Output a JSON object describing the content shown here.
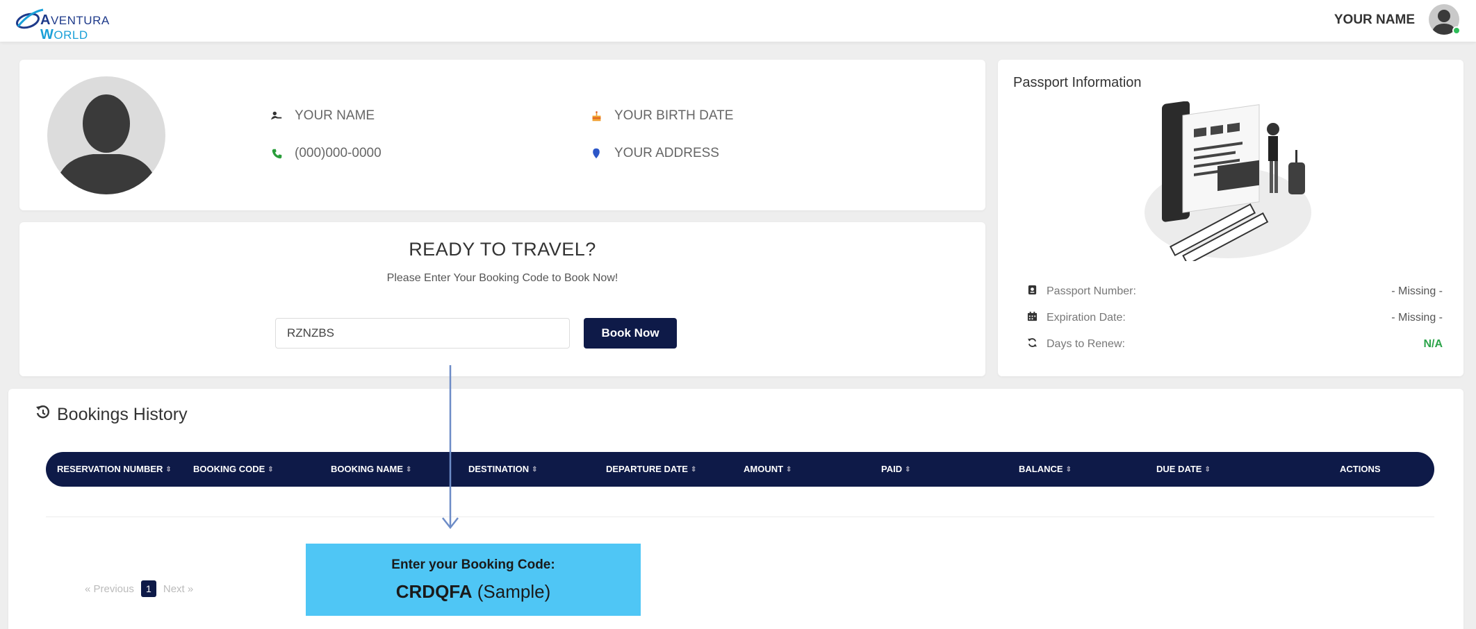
{
  "header": {
    "logo_line1_initial": "A",
    "logo_line1_rest": "VENTURA",
    "logo_line2_initial": "W",
    "logo_line2_rest": "ORLD",
    "user_name": "YOUR NAME"
  },
  "profile": {
    "name": "YOUR NAME",
    "phone": "(000)000-0000",
    "birth_date": "YOUR BIRTH DATE",
    "address": "YOUR ADDRESS"
  },
  "ready": {
    "title": "READY TO TRAVEL?",
    "subtitle": "Please Enter Your Booking Code to Book Now!",
    "code_value": "RZNZBS",
    "book_button": "Book Now"
  },
  "passport": {
    "title": "Passport Information",
    "rows": [
      {
        "label": "Passport Number:",
        "value": "- Missing -",
        "icon": "passport-icon"
      },
      {
        "label": "Expiration Date:",
        "value": "- Missing -",
        "icon": "calendar-icon"
      },
      {
        "label": "Days to Renew:",
        "value": "N/A",
        "icon": "refresh-icon"
      }
    ]
  },
  "bookings": {
    "title": "Bookings History",
    "columns": [
      "RESERVATION NUMBER",
      "BOOKING CODE",
      "BOOKING NAME",
      "DESTINATION",
      "DEPARTURE DATE",
      "AMOUNT",
      "PAID",
      "BALANCE",
      "DUE DATE",
      "ACTIONS"
    ],
    "pager": {
      "previous": "« Previous",
      "current": "1",
      "next": "Next »"
    }
  },
  "callout": {
    "line1": "Enter your Booking Code:",
    "code": "CRDQFA",
    "suffix": "(Sample)"
  },
  "colors": {
    "navy": "#0e1a48",
    "callout": "#4fc6f5",
    "success": "#2ca44a",
    "online": "#2ebd59"
  }
}
